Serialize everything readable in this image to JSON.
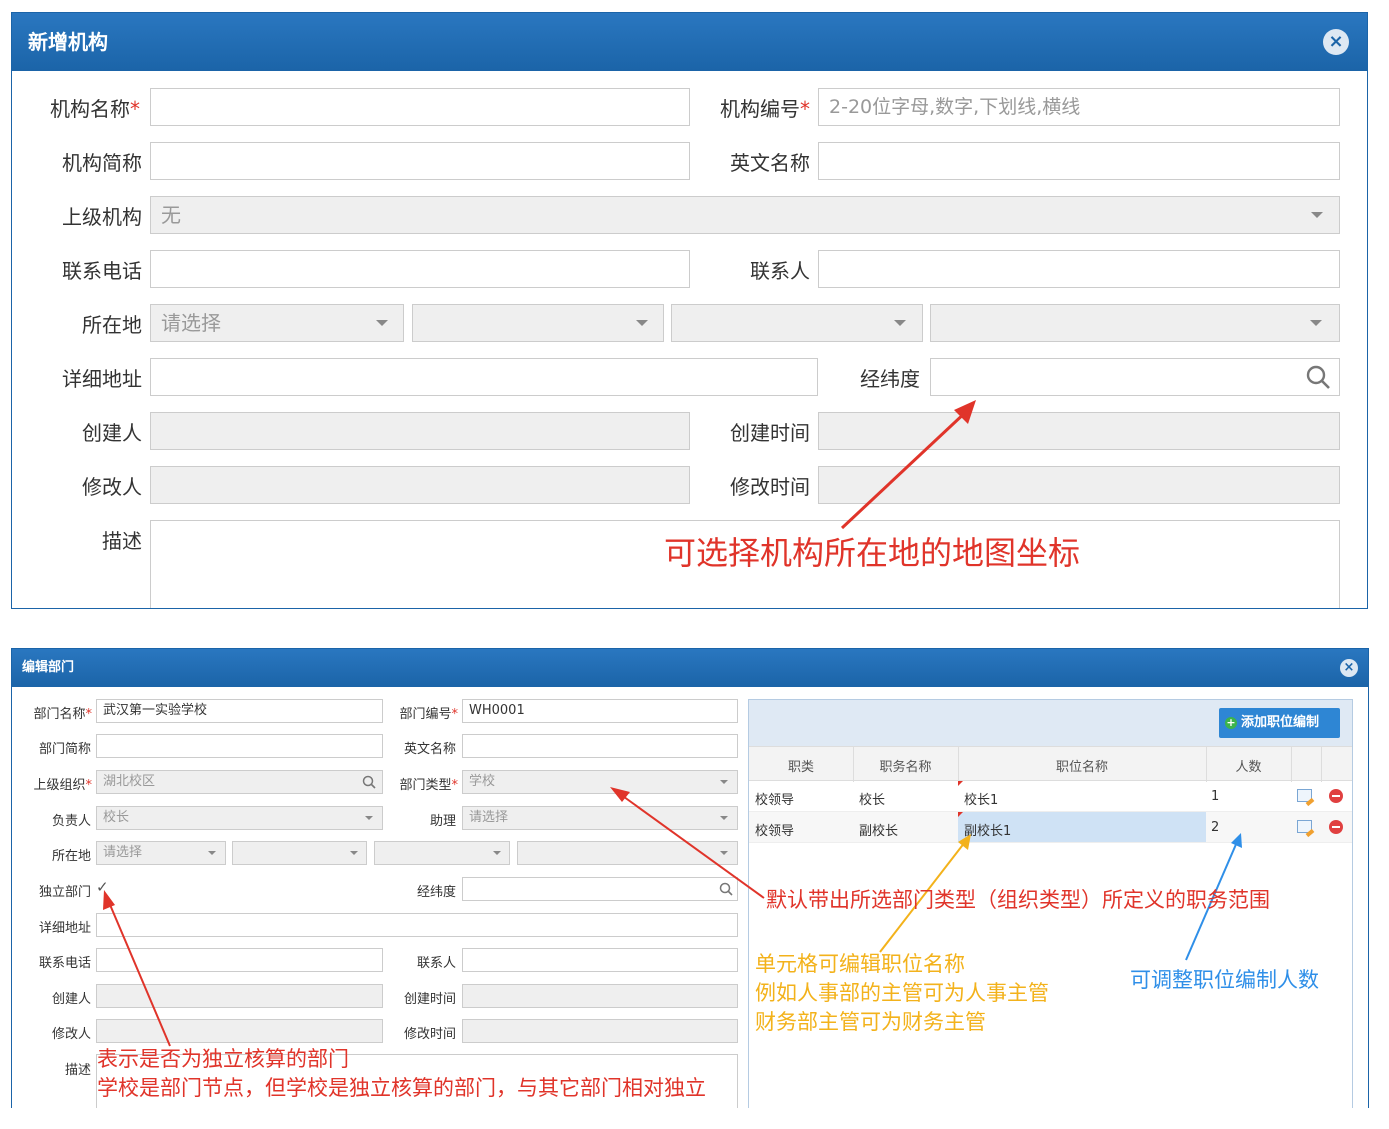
{
  "top_dialog": {
    "title": "新增机构",
    "close_icon": "close-circle-icon",
    "fields": {
      "org_name_label": "机构名称",
      "org_code_label": "机构编号",
      "org_code_placeholder": "2-20位字母,数字,下划线,横线",
      "short_name_label": "机构简称",
      "english_name_label": "英文名称",
      "parent_org_label": "上级机构",
      "parent_org_value": "无",
      "phone_label": "联系电话",
      "contact_label": "联系人",
      "location_label": "所在地",
      "location_placeholder": "请选择",
      "address_label": "详细地址",
      "latlng_label": "经纬度",
      "creator_label": "创建人",
      "created_time_label": "创建时间",
      "modifier_label": "修改人",
      "modified_time_label": "修改时间",
      "description_label": "描述"
    },
    "annotation": "可选择机构所在地的地图坐标"
  },
  "bottom_dialog": {
    "title": "编辑部门",
    "close_icon": "close-circle-icon",
    "fields": {
      "dept_name_label": "部门名称",
      "dept_name_value": "武汉第一实验学校",
      "dept_code_label": "部门编号",
      "dept_code_value": "WH0001",
      "dept_short_label": "部门简称",
      "english_name_label": "英文名称",
      "parent_org_label": "上级组织",
      "parent_org_value": "湖北校区",
      "dept_type_label": "部门类型",
      "dept_type_value": "学校",
      "leader_label": "负责人",
      "leader_value": "校长",
      "assistant_label": "助理",
      "assistant_placeholder": "请选择",
      "location_label": "所在地",
      "location_placeholder": "请选择",
      "independent_label": "独立部门",
      "latlng_label": "经纬度",
      "address_label": "详细地址",
      "phone_label": "联系电话",
      "contact_label": "联系人",
      "creator_label": "创建人",
      "created_time_label": "创建时间",
      "modifier_label": "修改人",
      "modified_time_label": "修改时间",
      "description_label": "描述"
    },
    "add_position_button": "添加职位编制",
    "table": {
      "headers": [
        "职类",
        "职务名称",
        "职位名称",
        "人数"
      ],
      "rows": [
        {
          "category": "校领导",
          "duty": "校长",
          "position": "校长1",
          "count": "1"
        },
        {
          "category": "校领导",
          "duty": "副校长",
          "position": "副校长1",
          "count": "2"
        }
      ]
    },
    "annotations": {
      "duty_range": "默认带出所选部门类型（组织类型）所定义的职务范围",
      "editable_line1": "单元格可编辑职位名称",
      "editable_line2": "例如人事部的主管可为人事主管",
      "editable_line3": "财务部主管可为财务主管",
      "adjust_count": "可调整职位编制人数",
      "independent_line1": "表示是否为独立核算的部门",
      "independent_line2": "学校是部门节点，但学校是独立核算的部门，与其它部门相对独立"
    }
  },
  "colors": {
    "title_bar": "#1b64a8",
    "required": "#e0342a",
    "annotation_red": "#e0342a",
    "annotation_orange": "#f3b21b",
    "annotation_blue": "#2f8fe8",
    "add_button": "#2e86d4",
    "selected_cell": "#cfe2f5"
  }
}
